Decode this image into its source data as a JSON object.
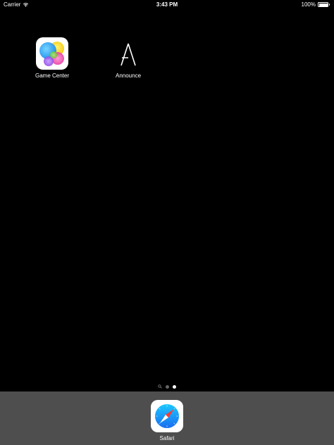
{
  "status_bar": {
    "carrier": "Carrier",
    "time": "3:43 PM",
    "battery": "100%"
  },
  "home": {
    "apps": [
      {
        "label": "Game Center",
        "icon": "game-center-icon"
      },
      {
        "label": "Announce",
        "icon": "announce-icon"
      }
    ]
  },
  "page_indicator": {
    "pages": 2,
    "current": 2,
    "has_search_page": true
  },
  "dock": {
    "apps": [
      {
        "label": "Safari",
        "icon": "safari-icon"
      }
    ]
  },
  "colors": {
    "background": "#000000",
    "dock": "#4e4e4e",
    "safari_blue": "#1a8cff"
  }
}
